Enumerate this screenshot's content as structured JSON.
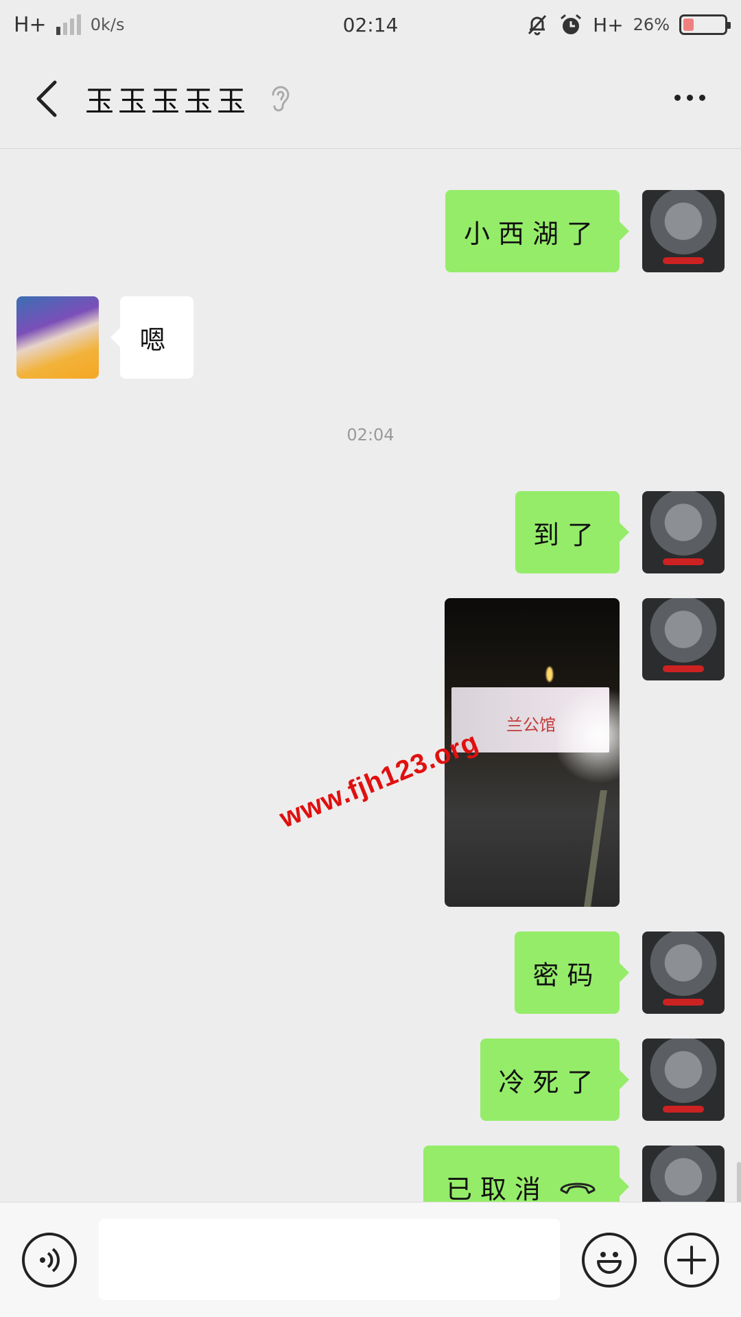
{
  "status_bar": {
    "network": "H+",
    "speed": "0k/s",
    "time": "02:14",
    "network_right": "H+",
    "battery_pct": "26%",
    "battery_level": 0.26,
    "icons": [
      "signal-icon",
      "bell-muted-icon",
      "alarm-icon",
      "battery-icon"
    ]
  },
  "header": {
    "title": "玉玉玉玉玉",
    "icons": [
      "back-icon",
      "ear-icon",
      "more-icon"
    ]
  },
  "messages": [
    {
      "side": "out",
      "text": "小西湖了"
    },
    {
      "side": "in",
      "text": "嗯"
    },
    {
      "type": "timestamp",
      "text": "02:04"
    },
    {
      "side": "out",
      "text": "到了"
    },
    {
      "side": "out",
      "type": "image",
      "sign_text": "兰公馆"
    },
    {
      "side": "out",
      "text": "密码"
    },
    {
      "side": "out",
      "text": "冷死了"
    },
    {
      "side": "out",
      "text": "已取消",
      "icon": "hangup-icon"
    }
  ],
  "watermark": "www.fjh123.org",
  "input_bar": {
    "icons": [
      "voice-icon",
      "emoji-icon",
      "plus-icon"
    ],
    "placeholder": ""
  },
  "colors": {
    "background": "#ededed",
    "out_bubble": "#95ec69",
    "in_bubble": "#ffffff",
    "watermark": "#e01010"
  }
}
